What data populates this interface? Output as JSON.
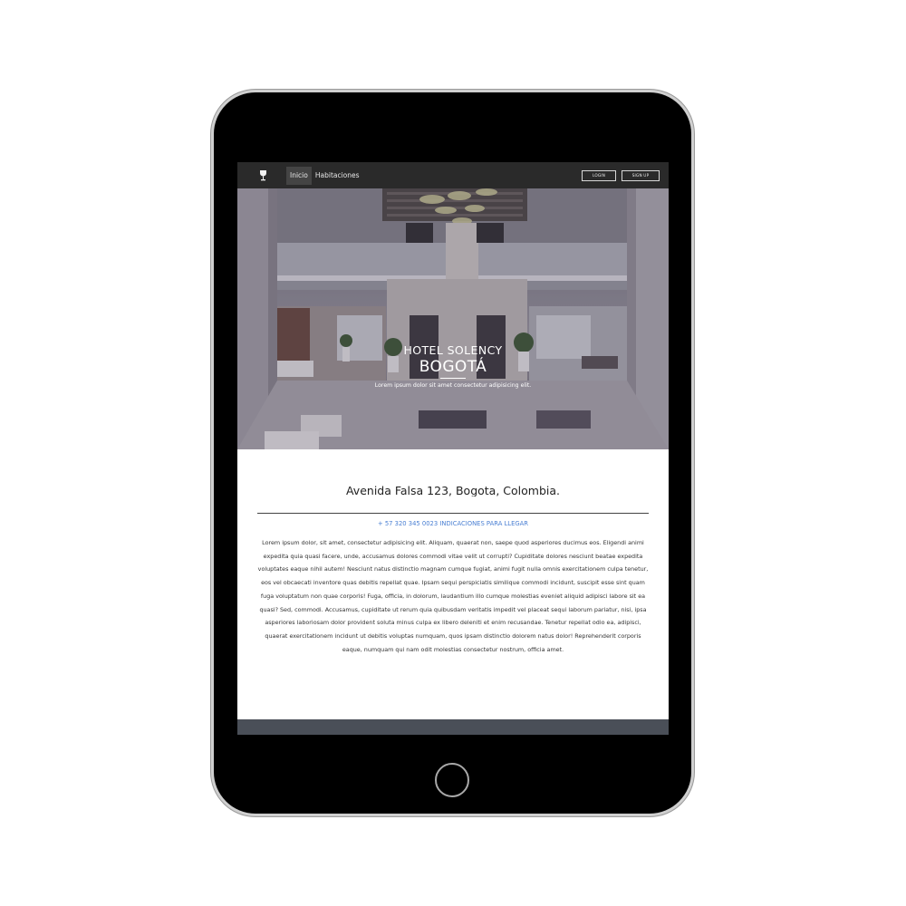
{
  "nav": {
    "links": [
      {
        "label": "Inicio",
        "active": true
      },
      {
        "label": "Habitaciones",
        "active": false
      }
    ],
    "login_label": "LOGIN",
    "signup_label": "SIGN UP",
    "brand_icon": "wine-glass-icon"
  },
  "hero": {
    "title": "HOTEL SOLENCY",
    "city": "BOGOTÁ",
    "tagline": "Lorem ipsum dolor sit amet consectetur adipisicing elit."
  },
  "info": {
    "address": "Avenida Falsa 123, Bogota, Colombia.",
    "phone": "+ 57 320 345 0023",
    "directions_link": "INDICACIONES PARA LLEGAR",
    "body": "Lorem ipsum dolor, sit amet, consectetur adipisicing elit. Aliquam, quaerat non, saepe quod asperiores ducimus eos. Eligendi animi expedita quia quasi facere, unde, accusamus dolores commodi vitae velit ut corrupti? Cupiditate dolores nesciunt beatae expedita voluptates eaque nihil autem! Nesciunt natus distinctio magnam cumque fugiat, animi fugit nulla omnis exercitationem culpa tenetur, eos vel obcaecati inventore quas debitis repellat quae. Ipsam sequi perspiciatis similique commodi incidunt, suscipit esse sint quam fuga voluptatum non quae corporis! Fuga, officia, in dolorum, laudantium illo cumque molestias eveniet aliquid adipisci labore sit ea quasi? Sed, commodi. Accusamus, cupiditate ut rerum quia quibusdam veritatis impedit vel placeat sequi laborum pariatur, nisi, ipsa asperiores laboriosam dolor provident soluta minus culpa ex libero deleniti et enim recusandae. Tenetur repellat odio ea, adipisci, quaerat exercitationem incidunt ut debitis voluptas numquam, quos ipsam distinctio dolorem natus dolor! Reprehenderit corporis eaque, numquam qui nam odit molestias consectetur nostrum, officia amet."
  },
  "colors": {
    "navbar": "#2a2a2a",
    "link_blue": "#4a7fd3",
    "footer": "#4a4f58"
  }
}
